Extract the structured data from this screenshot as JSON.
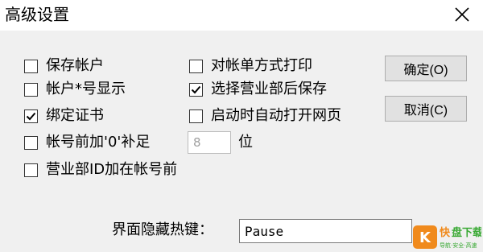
{
  "window": {
    "title": "高级设置",
    "close_icon": "close-icon"
  },
  "options": [
    {
      "label": "保存帐户",
      "checked": false
    },
    {
      "label": "帐户*号显示",
      "checked": false
    },
    {
      "label": "绑定证书",
      "checked": true
    },
    {
      "label": "帐号前加'0'补足",
      "checked": false
    },
    {
      "label": "营业部ID加在帐号前",
      "checked": false
    },
    {
      "label": "对帐单方式打印",
      "checked": false
    },
    {
      "label": "选择营业部后保存",
      "checked": true
    },
    {
      "label": "启动时自动打开网页",
      "checked": false
    }
  ],
  "pad_length": {
    "value": "8",
    "unit": "位"
  },
  "buttons": {
    "ok": "确定(O)",
    "cancel": "取消(C)"
  },
  "hotkey": {
    "label": "界面隐藏热键：",
    "value": "Pause"
  },
  "watermark": {
    "logo_text": "快",
    "name": "盘下载",
    "tagline": "导航·安全·高速",
    "colors": {
      "orange": "#f08a1c",
      "green": "#3aa935"
    }
  }
}
